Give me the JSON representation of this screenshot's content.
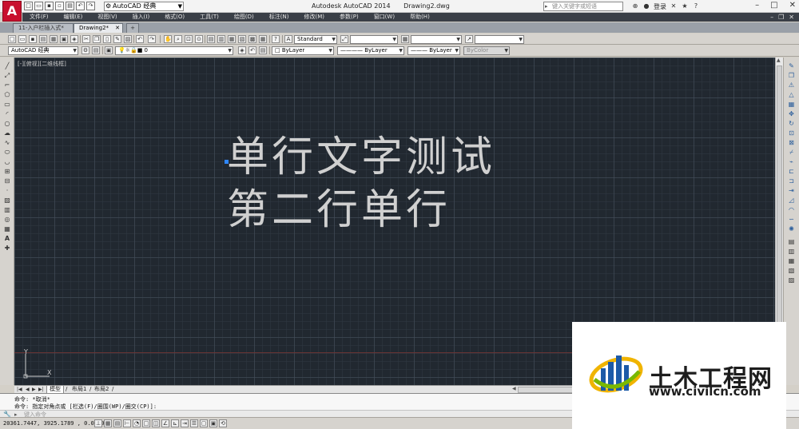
{
  "title_bar": {
    "logo_letter": "A",
    "workspace": "AutoCAD 经典",
    "app_name": "Autodesk AutoCAD 2014",
    "file_name": "Drawing2.dwg",
    "search_placeholder": "键入关键字或短语",
    "sign_in": "登录"
  },
  "menu": {
    "items": [
      "文件(F)",
      "编辑(E)",
      "视图(V)",
      "插入(I)",
      "格式(O)",
      "工具(T)",
      "绘图(D)",
      "标注(N)",
      "修改(M)",
      "参数(P)",
      "窗口(W)",
      "帮助(H)"
    ]
  },
  "tabs": {
    "drawing1": "11-入户栏插入式*",
    "drawing2": "Drawing2*"
  },
  "toolbar": {
    "text_style": "Standard",
    "workspace2": "AutoCAD 经典",
    "layer": "0",
    "color": "ByLayer",
    "linetype": "ByLayer",
    "lineweight": "ByLayer",
    "plotstyle": "ByColor"
  },
  "canvas": {
    "viewport_label": "[-][俯视][二维线框]",
    "text_line_1": "单行文字测试",
    "text_line_2": "第二行单行",
    "ucs_y": "Y",
    "ucs_x": "X"
  },
  "layout_tabs": {
    "model": "模型",
    "layout1": "布局1",
    "layout2": "布局2"
  },
  "command": {
    "line1": "命令: *取消*",
    "line2": "命令: 指定对角点或 [栏选(F)/圈围(WP)/圈交(CP)]:",
    "input_placeholder": "键入命令"
  },
  "status": {
    "coords": "20361.7447, 3925.1789 , 0.0000"
  },
  "watermark": {
    "name": "土木工程网",
    "url": "www.civilcn.com"
  },
  "colors": {
    "canvas_bg": "#212830",
    "grip": "#2e86ff",
    "logo_red": "#c8102e"
  }
}
